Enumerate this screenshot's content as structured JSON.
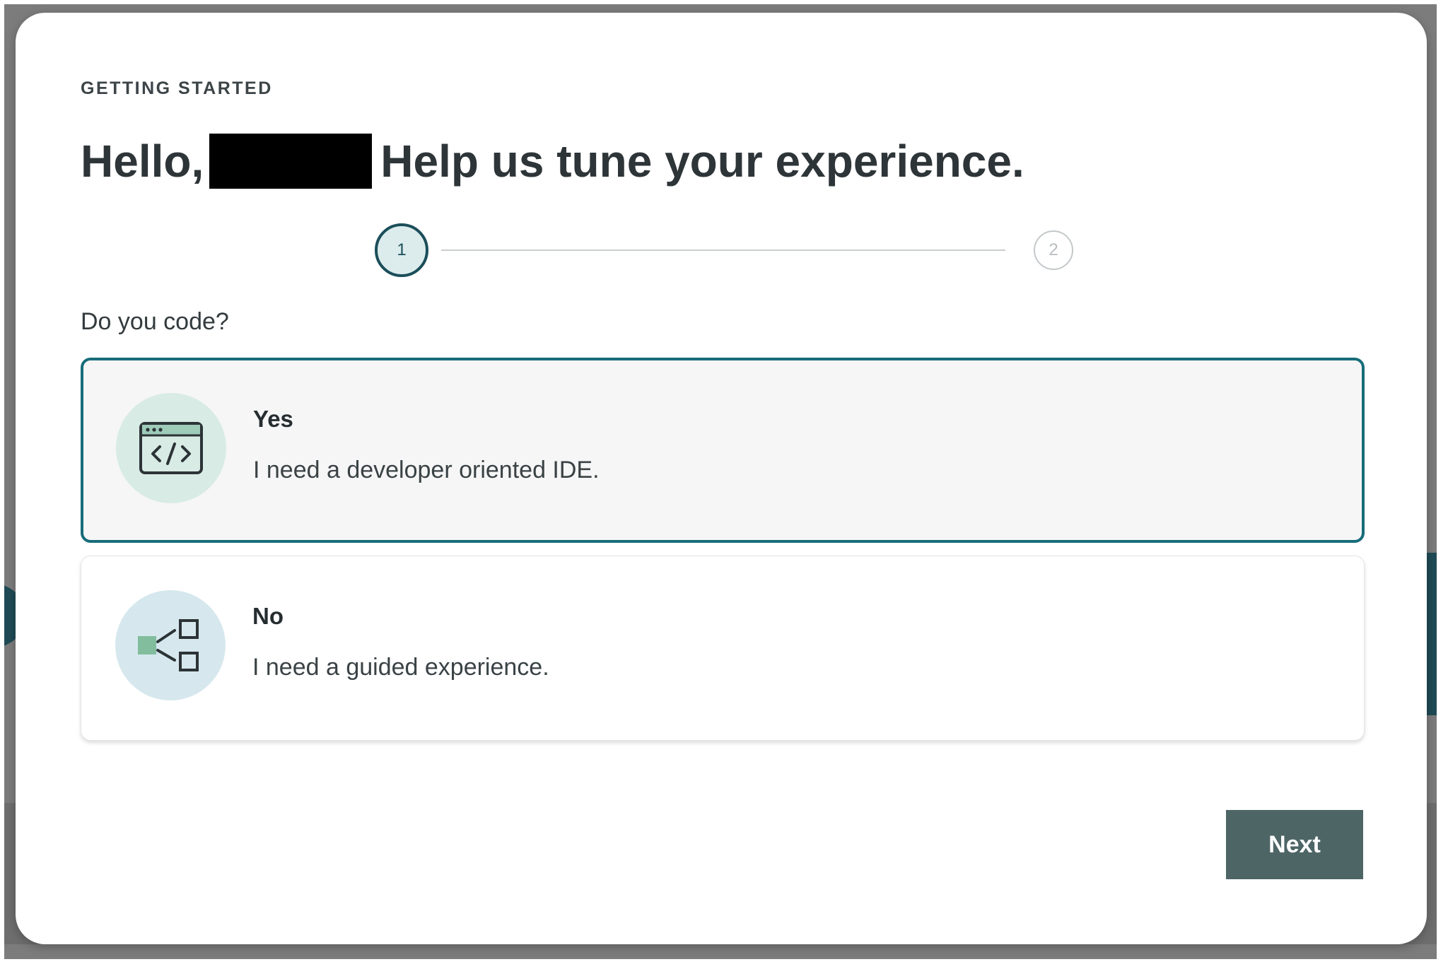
{
  "dialog": {
    "eyebrow": "GETTING STARTED",
    "title_greeting": "Hello,",
    "title_message": "Help us tune your experience.",
    "stepper": {
      "steps": [
        {
          "label": "1",
          "state": "active"
        },
        {
          "label": "2",
          "state": "inactive"
        }
      ]
    },
    "question": "Do you code?",
    "options": [
      {
        "label": "Yes",
        "description": "I need a developer oriented IDE.",
        "icon": "code-window-icon",
        "selected": true
      },
      {
        "label": "No",
        "description": "I need a guided experience.",
        "icon": "branching-nodes-icon",
        "selected": false
      }
    ],
    "next_label": "Next"
  },
  "colors": {
    "accent_border": "#176c7a",
    "step_active": "#1b4e5a",
    "button_bg": "#4e6566",
    "backdrop": "#7c7c7c"
  }
}
